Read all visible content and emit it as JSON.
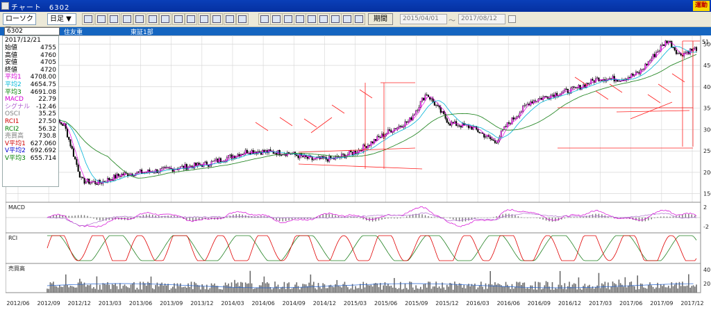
{
  "window": {
    "title": "チャート　6302",
    "badge": "運動"
  },
  "toolbar": {
    "chart_type": "ローソク ▼",
    "period": "日足 ▼",
    "period_btn": "期間",
    "date_from": "2015/04/01",
    "date_to": "2017/08/12",
    "date_sep": "〜"
  },
  "infobar": {
    "code": "6302",
    "name": "住友重",
    "market": "東証1部"
  },
  "panel": {
    "date": "2017/12/21",
    "rows": [
      {
        "k": "始値",
        "v": "4755",
        "c": "#000"
      },
      {
        "k": "高値",
        "v": "4760",
        "c": "#000"
      },
      {
        "k": "安値",
        "v": "4705",
        "c": "#000"
      },
      {
        "k": "終値",
        "v": "4720",
        "c": "#000"
      },
      {
        "k": "平均1",
        "v": "4708.00",
        "c": "#d400d4"
      },
      {
        "k": "平均2",
        "v": "4654.75",
        "c": "#00b8d8"
      },
      {
        "k": "平均3",
        "v": "4691.08",
        "c": "#008000"
      },
      {
        "k": "MACD",
        "v": "22.79",
        "c": "#d400d4"
      },
      {
        "k": "シグナル",
        "v": "-12.46",
        "c": "#b060d0"
      },
      {
        "k": "OSCI",
        "v": "35.25",
        "c": "#808080"
      },
      {
        "k": "RCI1",
        "v": "27.50",
        "c": "#d00000"
      },
      {
        "k": "RCI2",
        "v": "56.32",
        "c": "#008000"
      },
      {
        "k": "売買高",
        "v": "730.8",
        "c": "#808080"
      },
      {
        "k": "V平均1",
        "v": "627.060",
        "c": "#d00000"
      },
      {
        "k": "V平均2",
        "v": "692.692",
        "c": "#0000d0"
      },
      {
        "k": "V平均3",
        "v": "655.714",
        "c": "#008000"
      }
    ]
  },
  "chart_data": {
    "type": "line",
    "x_labels": [
      "2012/06",
      "2012/09",
      "2012/12",
      "2013/03",
      "2013/06",
      "2013/09",
      "2013/12",
      "2014/03",
      "2014/06",
      "2014/09",
      "2014/12",
      "2015/03",
      "2015/06",
      "2015/09",
      "2015/12",
      "2016/03",
      "2016/06",
      "2016/09",
      "2016/12",
      "2017/03",
      "2017/06",
      "2017/09",
      "2017/12"
    ],
    "y_ticks": [
      150,
      200,
      250,
      300,
      350,
      400,
      450,
      500
    ],
    "y_last": "51",
    "price_path": [
      [
        0,
        330
      ],
      [
        3,
        310
      ],
      [
        6,
        180
      ],
      [
        9,
        175
      ],
      [
        13,
        195
      ],
      [
        20,
        205
      ],
      [
        28,
        220
      ],
      [
        35,
        250
      ],
      [
        42,
        245
      ],
      [
        46,
        230
      ],
      [
        50,
        232
      ],
      [
        54,
        250
      ],
      [
        57,
        275
      ],
      [
        60,
        300
      ],
      [
        63,
        320
      ],
      [
        66,
        385
      ],
      [
        70,
        315
      ],
      [
        74,
        305
      ],
      [
        78,
        270
      ],
      [
        80,
        310
      ],
      [
        84,
        365
      ],
      [
        88,
        382
      ],
      [
        92,
        395
      ],
      [
        96,
        420
      ],
      [
        100,
        418
      ],
      [
        103,
        432
      ],
      [
        106,
        480
      ],
      [
        108,
        510
      ],
      [
        110,
        475
      ],
      [
        113,
        490
      ]
    ],
    "macd_label": "MACD",
    "macd_ticks": [
      "2",
      "-2"
    ],
    "rci_label": "RCI",
    "vol_label": "売買高",
    "vol_ticks": [
      "40",
      "20"
    ]
  }
}
